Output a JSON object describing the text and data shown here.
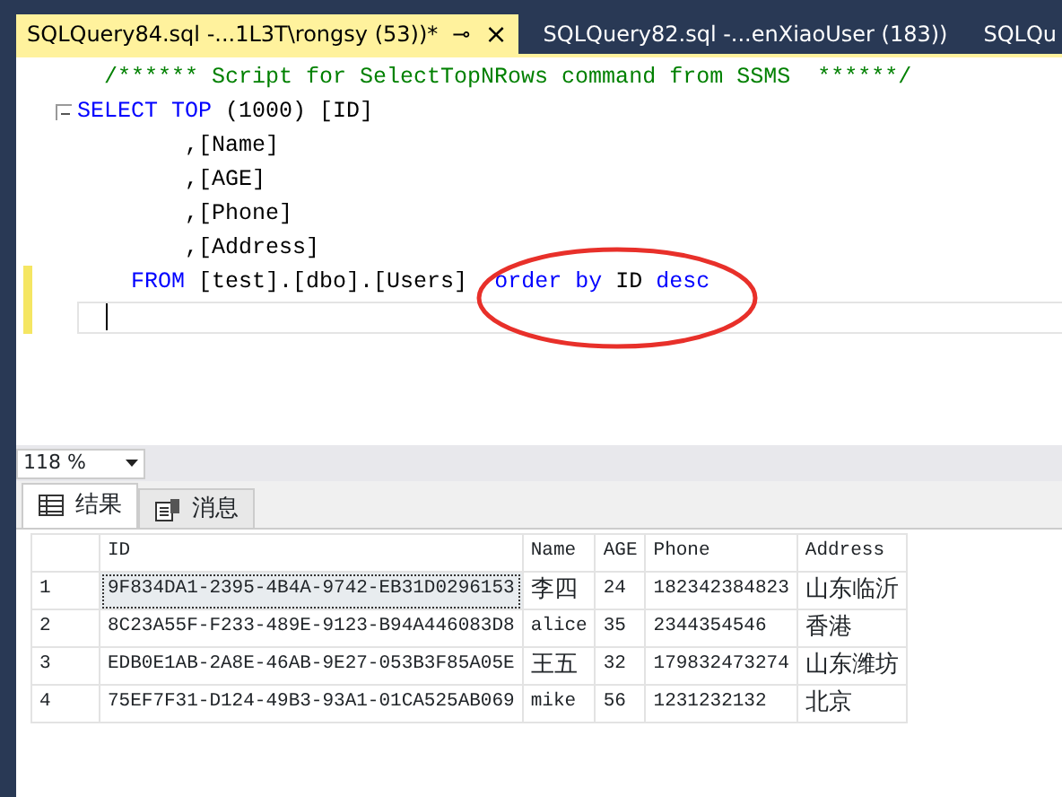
{
  "tabs": [
    {
      "label": "SQLQuery84.sql -...1L3T\\rongsy (53))*",
      "selected": true,
      "pin": "⊸",
      "close": "×"
    },
    {
      "label": "SQLQuery82.sql -...enXiaoUser (183))",
      "selected": false
    },
    {
      "label": "SQLQu",
      "selected": false
    }
  ],
  "editor": {
    "lines": [
      {
        "changed": false,
        "fold": false,
        "current": false,
        "tokens": [
          {
            "kind": "comment",
            "text": "/****** Script for SelectTopNRows command from SSMS  ******/"
          }
        ]
      },
      {
        "changed": false,
        "fold": true,
        "current": false,
        "tokens": [
          {
            "kind": "keyword",
            "text": "SELECT TOP"
          },
          {
            "kind": "plain",
            "text": " (1000) [ID]"
          }
        ]
      },
      {
        "changed": false,
        "fold": false,
        "current": false,
        "tokens": [
          {
            "kind": "plain",
            "text": "      ,[Name]"
          }
        ]
      },
      {
        "changed": false,
        "fold": false,
        "current": false,
        "tokens": [
          {
            "kind": "plain",
            "text": "      ,[AGE]"
          }
        ]
      },
      {
        "changed": false,
        "fold": false,
        "current": false,
        "tokens": [
          {
            "kind": "plain",
            "text": "      ,[Phone]"
          }
        ]
      },
      {
        "changed": false,
        "fold": false,
        "current": false,
        "tokens": [
          {
            "kind": "plain",
            "text": "      ,[Address]"
          }
        ]
      },
      {
        "changed": true,
        "fold": false,
        "current": false,
        "tokens": [
          {
            "kind": "keyword",
            "text": "  FROM"
          },
          {
            "kind": "plain",
            "text": " [test].[dbo].[Users]  "
          },
          {
            "kind": "keyword",
            "text": "order by"
          },
          {
            "kind": "plain",
            "text": " ID "
          },
          {
            "kind": "keyword",
            "text": "desc"
          }
        ]
      },
      {
        "changed": true,
        "fold": false,
        "current": true
      }
    ]
  },
  "zoom": {
    "value": "118 %"
  },
  "result_tabs": [
    {
      "label": "结果",
      "selected": true
    },
    {
      "label": "消息",
      "selected": false
    }
  ],
  "grid": {
    "columns": [
      "ID",
      "Name",
      "AGE",
      "Phone",
      "Address"
    ],
    "rows": [
      {
        "num": "1",
        "cells": [
          "9F834DA1-2395-4B4A-9742-EB31D0296153",
          "李四",
          "24",
          "182342384823",
          "山东临沂"
        ],
        "first_cell_selected": true
      },
      {
        "num": "2",
        "cells": [
          "8C23A55F-F233-489E-9123-B94A446083D8",
          "alice",
          "35",
          "2344354546",
          "香港"
        ],
        "first_cell_selected": false
      },
      {
        "num": "3",
        "cells": [
          "EDB0E1AB-2A8E-46AB-9E27-053B3F85A05E",
          "王五",
          "32",
          "179832473274",
          "山东潍坊"
        ],
        "first_cell_selected": false
      },
      {
        "num": "4",
        "cells": [
          "75EF7F31-D124-49B3-93A1-01CA525AB069",
          "mike",
          "56",
          "1231232132",
          "北京"
        ],
        "first_cell_selected": false
      }
    ]
  }
}
